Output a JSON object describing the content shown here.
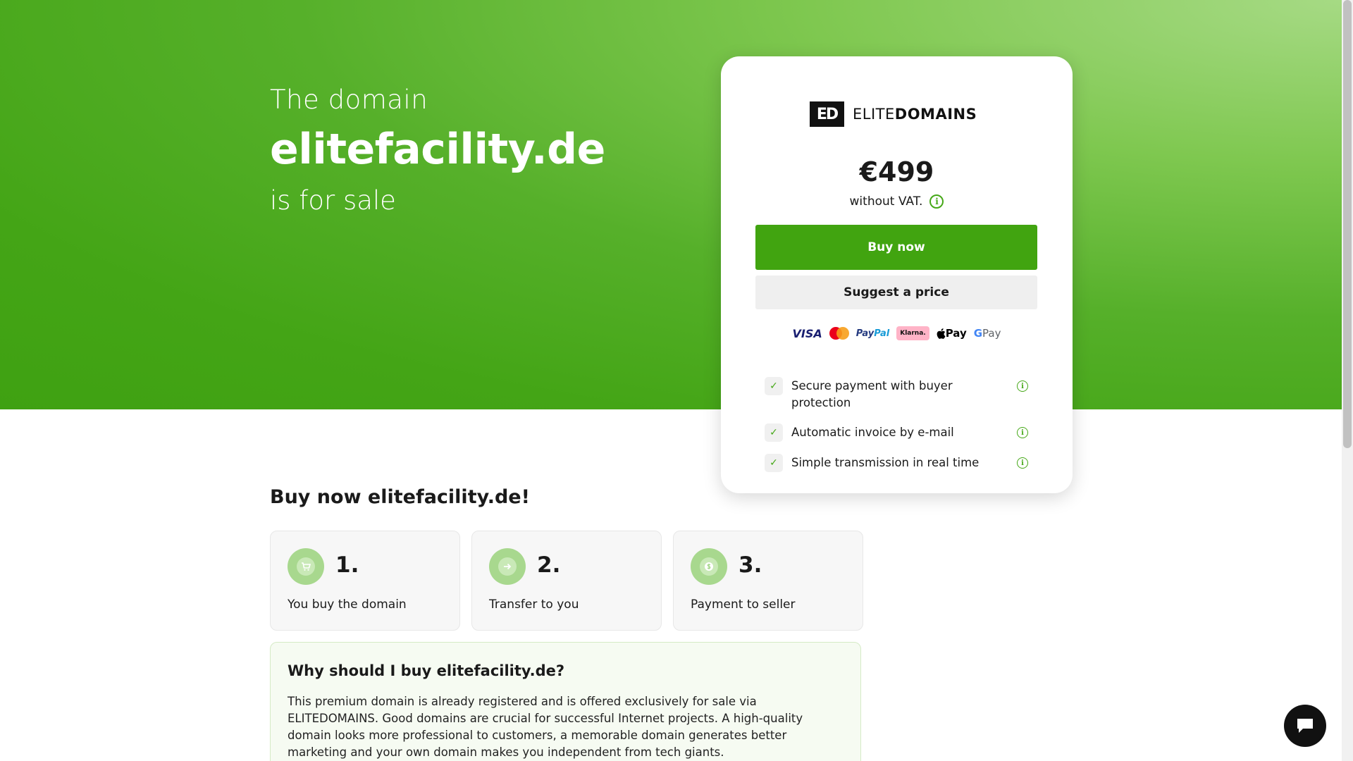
{
  "hero": {
    "pre": "The domain",
    "domain": "elitefacility.de",
    "post": "is for sale"
  },
  "card": {
    "logo_mark": "ED",
    "logo_text_light": "ELITE",
    "logo_text_bold": "DOMAINS",
    "price": "€499",
    "vat_note": "without VAT.",
    "buy_label": "Buy now",
    "suggest_label": "Suggest a price",
    "payments": {
      "visa": "VISA",
      "paypal_a": "Pay",
      "paypal_b": "Pal",
      "klarna": "Klarna.",
      "apple": "Pay",
      "google_g": "G",
      "google": " Pay"
    },
    "features": [
      "Secure payment with buyer protection",
      "Automatic invoice by e-mail",
      "Simple transmission in real time"
    ]
  },
  "section": {
    "title": "Buy now elitefacility.de!"
  },
  "steps": [
    {
      "number": "1.",
      "label": "You buy the domain",
      "icon": "cart-icon"
    },
    {
      "number": "2.",
      "label": "Transfer to you",
      "icon": "arrow-right-icon"
    },
    {
      "number": "3.",
      "label": "Payment to seller",
      "icon": "dollar-icon"
    }
  ],
  "why": {
    "title": "Why should I buy elitefacility.de?",
    "body": "This premium domain is already registered and is offered exclusively for sale via ELITEDOMAINS. Good domains are crucial for successful Internet projects. A high-quality domain looks more professional to customers, a memorable domain generates better marketing and your own domain makes you independent from tech giants."
  },
  "colors": {
    "brand_green": "#41a410",
    "hero_light": "#a6da84"
  }
}
